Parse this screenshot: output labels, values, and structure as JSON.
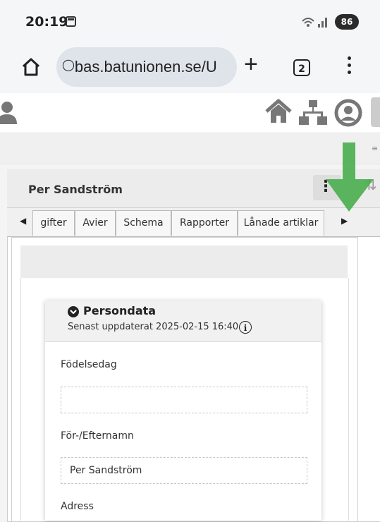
{
  "status_bar": {
    "time": "20:19",
    "battery": "86"
  },
  "browser": {
    "url": "bas.batunionen.se/U",
    "tab_count": "2"
  },
  "panel": {
    "title": "Per Sandström"
  },
  "tabs": [
    "gifter",
    "Avier",
    "Schema",
    "Rapporter",
    "Lånade artiklar"
  ],
  "card": {
    "title": "Persondata",
    "subtitle": "Senast uppdaterat 2025-02-15 16:40",
    "info_glyph": "i",
    "fields": [
      {
        "label": "Födelsedag",
        "value": ""
      },
      {
        "label": "För-/Efternamn",
        "value": "Per Sandström"
      },
      {
        "label": "Adress",
        "value": ""
      }
    ]
  },
  "colors": {
    "arrow": "#4caf50",
    "header_icons": "#777777"
  }
}
